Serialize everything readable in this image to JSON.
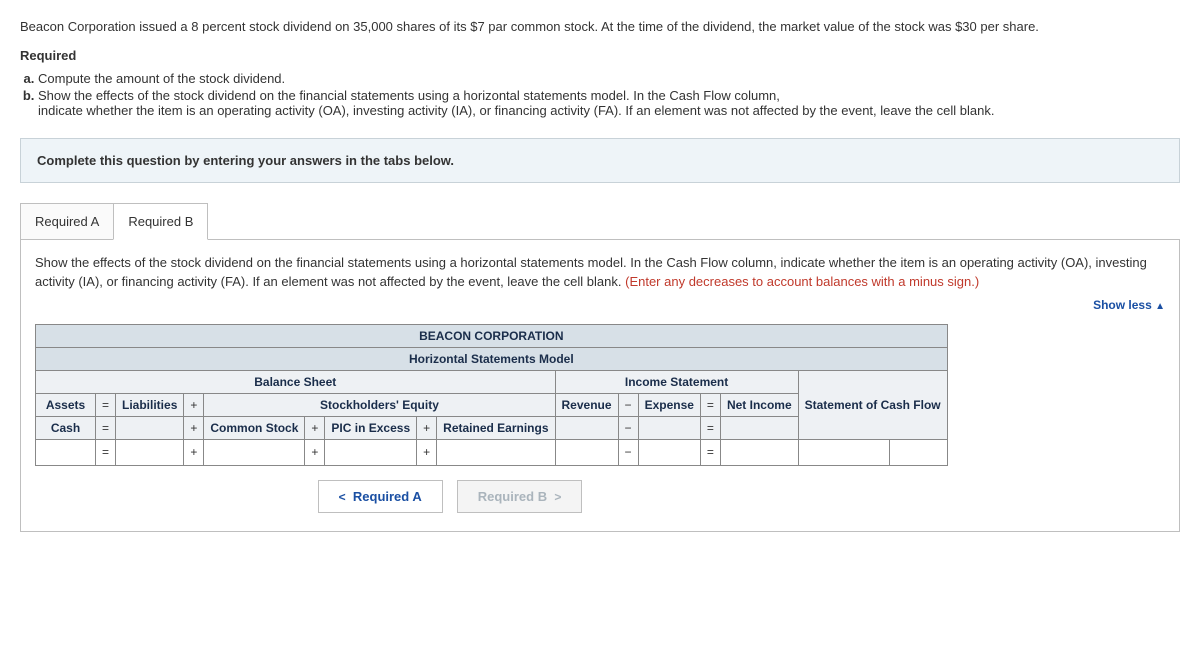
{
  "intro": {
    "text": "Beacon Corporation issued a 8 percent stock dividend on 35,000 shares of its $7 par common stock. At the time of the dividend, the market value of the stock was $30 per share."
  },
  "required_heading": "Required",
  "requirements": {
    "a": "Compute the amount of the stock dividend.",
    "b_lead": "Show the effects of the stock dividend on the financial statements using a horizontal statements model. In the Cash Flow column,",
    "b_sub": "indicate whether the item is an operating activity (OA), investing activity (IA), or financing activity (FA). If an element was not affected by the event, leave the cell blank."
  },
  "instruction_bar": "Complete this question by entering your answers in the tabs below.",
  "tabs": {
    "a": "Required A",
    "b": "Required B"
  },
  "panel": {
    "desc_main": "Show the effects of the stock dividend on the financial statements using a horizontal statements model. In the Cash Flow column, indicate whether the item is an operating activity (OA), investing activity (IA), or financing activity (FA). If an element was not affected by the event, leave the cell blank. ",
    "desc_red": "(Enter any decreases to account balances with a minus sign.)",
    "show_less": "Show less"
  },
  "table": {
    "corp": "BEACON CORPORATION",
    "model": "Horizontal Statements Model",
    "balance_sheet": "Balance Sheet",
    "income_statement": "Income Statement",
    "assets": "Assets",
    "liabilities": "Liabilities",
    "stockholders_equity": "Stockholders' Equity",
    "revenue": "Revenue",
    "expense": "Expense",
    "net_income": "Net Income",
    "cash_flow": "Statement of Cash Flow",
    "cash": "Cash",
    "common_stock": "Common Stock",
    "pic_excess": "PIC in Excess",
    "retained_earnings": "Retained Earnings",
    "eq": "=",
    "plus": "+",
    "minus": "−"
  },
  "nav": {
    "prev": "Required A",
    "next": "Required B"
  }
}
